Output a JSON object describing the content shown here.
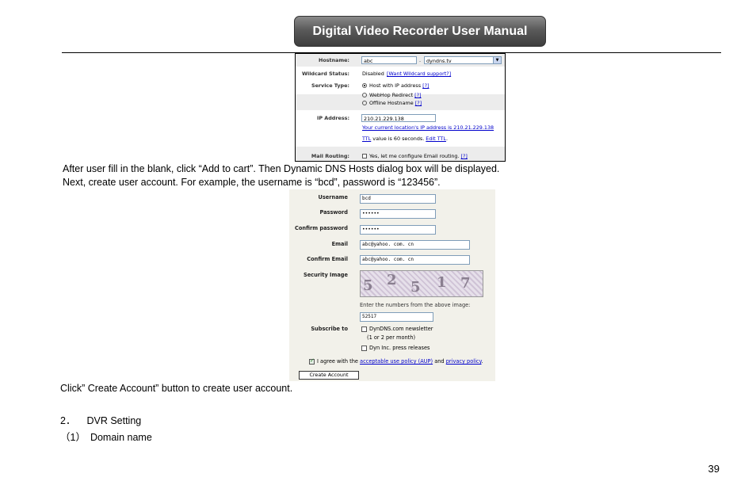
{
  "header": {
    "title": "Digital Video Recorder User Manual"
  },
  "shot1": {
    "hostname_label": "Hostname:",
    "hostname_value": "abc",
    "domain_value": "dyndns.tv",
    "wildcard_label": "Wildcard Status:",
    "wildcard_value": "Disabled",
    "wildcard_link": "[Want Wildcard support?]",
    "service_label": "Service Type:",
    "service_options": [
      "Host with IP address",
      "WebHop Redirect",
      "Offline Hostname"
    ],
    "help_mark": "[?]",
    "ip_label": "IP Address:",
    "ip_value": "210.21.229.138",
    "current_ip_text": "Your current location's IP address is 210.21.229.138",
    "ttl_link": "TTL",
    "ttl_text": " value is 60 seconds. ",
    "edit_ttl": "Edit TTL",
    "mail_label": "Mail Routing:",
    "mail_text": "Yes, let me configure Email routing."
  },
  "para1": "After user fill in the blank, click “Add to cart”. Then Dynamic DNS Hosts dialog box will be displayed.",
  "para2": "Next, create user account. For example, the username is “bcd”, password is “123456”.",
  "shot2": {
    "username_label": "Username",
    "username_value": "bcd",
    "password_label": "Password",
    "password_value": "••••••",
    "confirm_password_label": "Confirm password",
    "confirm_password_value": "••••••",
    "email_label": "Email",
    "email_value": "abc@yahoo. com. cn",
    "confirm_email_label": "Confirm Email",
    "confirm_email_value": "abc@yahoo. com. cn",
    "security_label": "Security Image",
    "captcha_digits": [
      "5",
      "2",
      "5",
      "1",
      "7"
    ],
    "captcha_hint": "Enter the numbers from the above image:",
    "captcha_value": "52517",
    "subscribe_label": "Subscribe to",
    "newsletter": "DynDNS.com newsletter",
    "newsletter_freq": "(1 or 2 per month)",
    "press": "Dyn Inc. press releases",
    "agree_prefix": "I agree with the ",
    "aup_link": "acceptable use policy (AUP)",
    "agree_and": " and ",
    "privacy_link": "privacy policy",
    "agree_end": ".",
    "create_button": "Create Account"
  },
  "para3": "Click” Create Account” button to create user account.",
  "section_2_num": "2．",
  "section_2_title": "DVR Setting",
  "section_2_1_num": "（1）",
  "section_2_1_title": "Domain name",
  "page_number": "39"
}
